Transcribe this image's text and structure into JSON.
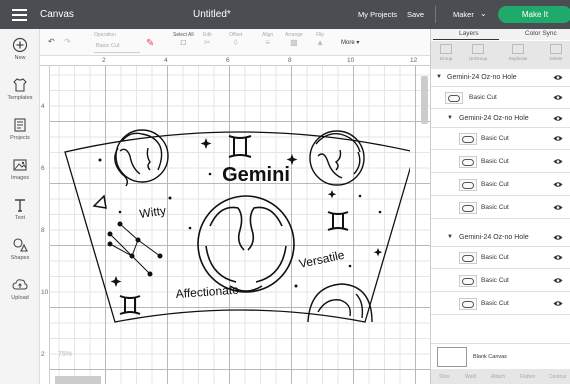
{
  "topbar": {
    "app_title": "Canvas",
    "doc_title": "Untitled*",
    "my_projects": "My Projects",
    "save": "Save",
    "machine": "Maker",
    "make_it": "Make It",
    "colors": {
      "bar": "#4a4e52",
      "make_button": "#1faa6b"
    }
  },
  "leftnav": [
    {
      "label": "New",
      "icon": "plus-icon"
    },
    {
      "label": "Templates",
      "icon": "shirt-icon"
    },
    {
      "label": "Projects",
      "icon": "projects-icon"
    },
    {
      "label": "Images",
      "icon": "image-icon"
    },
    {
      "label": "Text",
      "icon": "text-icon"
    },
    {
      "label": "Shapes",
      "icon": "shapes-icon"
    },
    {
      "label": "Upload",
      "icon": "upload-icon"
    }
  ],
  "toolbar": {
    "operation_label": "Operation",
    "operation_value": "Basic Cut",
    "select_all": "Select All",
    "edit": "Edit",
    "offset": "Offset",
    "align": "Align",
    "arrange": "Arrange",
    "flip": "Flip",
    "more": "More"
  },
  "rulers": {
    "top": [
      "2",
      "4",
      "6",
      "8",
      "10",
      "12"
    ],
    "left": [
      "4",
      "6",
      "8",
      "10",
      "2"
    ]
  },
  "canvas": {
    "zoom": "75%",
    "design_texts": {
      "gemini": "Gemini",
      "witty": "Witty",
      "versatile": "Versatile",
      "affectionate": "Affectionate"
    }
  },
  "panel": {
    "tabs": [
      "Layers",
      "Color Sync"
    ],
    "tools": [
      "Group",
      "UnGroup",
      "Duplicate",
      "Delete"
    ],
    "layers": [
      {
        "type": "group",
        "label": "Gemini-24 Oz-no Hole"
      },
      {
        "type": "item",
        "label": "Basic Cut"
      },
      {
        "type": "group",
        "label": "Gemini-24 Oz-no Hole"
      },
      {
        "type": "item",
        "label": "Basic Cut"
      },
      {
        "type": "item",
        "label": "Basic Cut"
      },
      {
        "type": "item",
        "label": "Basic Cut"
      },
      {
        "type": "item",
        "label": "Basic Cut"
      },
      {
        "type": "group",
        "label": "Gemini-24 Oz-no Hole"
      },
      {
        "type": "item",
        "label": "Basic Cut"
      },
      {
        "type": "item",
        "label": "Basic Cut"
      },
      {
        "type": "item",
        "label": "Basic Cut"
      }
    ],
    "blank_canvas": "Blank Canvas",
    "bottom_tools": [
      "Slice",
      "Weld",
      "Attach",
      "Flatten",
      "Contour"
    ]
  }
}
